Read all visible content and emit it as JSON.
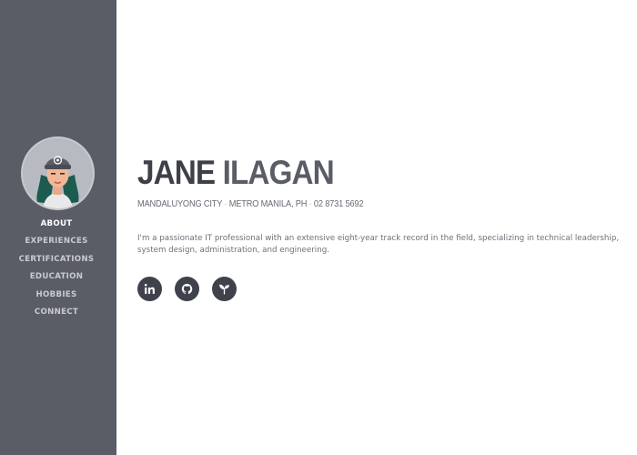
{
  "profile": {
    "first_name": "JANE",
    "last_name": "ILAGAN",
    "city": "MANDALUYONG CITY",
    "region": "METRO MANILA, PH",
    "phone": "02 8731 5692",
    "separator": "·",
    "bio": "I'm a passionate IT professional with an extensive eight-year track record in the field, specializing in technical leadership, system design, administration, and engineering."
  },
  "sidebar": {
    "items": [
      {
        "label": "ABOUT",
        "active": true
      },
      {
        "label": "EXPERIENCES",
        "active": false
      },
      {
        "label": "CERTIFICATIONS",
        "active": false
      },
      {
        "label": "EDUCATION",
        "active": false
      },
      {
        "label": "HOBBIES",
        "active": false
      },
      {
        "label": "CONNECT",
        "active": false
      }
    ]
  },
  "social": [
    {
      "icon": "linkedin-icon"
    },
    {
      "icon": "github-icon"
    },
    {
      "icon": "sprout-icon"
    }
  ],
  "colors": {
    "sidebar_bg": "#5a5d66",
    "name_dark": "#3d4048",
    "name_light": "#5a5d66",
    "icon_bg": "#3f424b"
  }
}
